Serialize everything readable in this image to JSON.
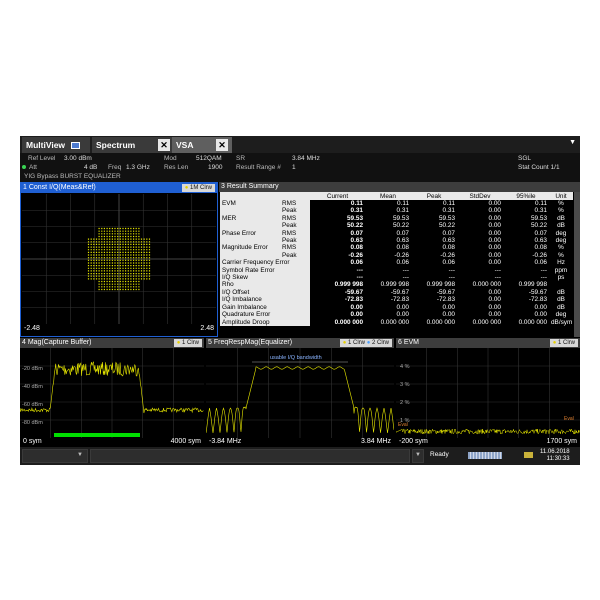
{
  "tabs": {
    "multiview": "MultiView",
    "spectrum": "Spectrum",
    "vsa": "VSA",
    "close": "✕"
  },
  "header": {
    "ref_level_label": "Ref Level",
    "ref_level_value": "3.00 dBm",
    "att_label": "Att",
    "att_value": "4 dB",
    "freq_label": "Freq",
    "freq_value": "1.3 GHz",
    "mod_label": "Mod",
    "mod_value": "512QAM",
    "sr_label": "SR",
    "sr_value": "3.84 MHz",
    "res_len_label": "Res Len",
    "res_len_value": "1900",
    "result_range_label": "Result Range #",
    "result_range_value": "1",
    "sgl": "SGL",
    "stat_count": "Stat Count 1/1",
    "yig_line": "YIG Bypass BURST EQUALIZER"
  },
  "windows": {
    "w1": {
      "title": "1 Const I/Q(Meas&Ref)",
      "badge": "1M Clrw",
      "x_min": "-2.48",
      "x_max": "2.48"
    },
    "w3": {
      "title": "3 Result Summary"
    },
    "w4": {
      "title": "4 Mag(Capture Buffer)",
      "badge": "1 Clrw",
      "x_min": "0 sym",
      "x_max": "4000 sym",
      "y_ticks": [
        "-20 dBm",
        "-40 dBm",
        "-60 dBm",
        "-80 dBm"
      ]
    },
    "w5": {
      "title": "5 FreqRespMag(Equalizer)",
      "badge": "1 Clrw",
      "badge2": "2 Clrw",
      "annotation": "usable I/Q bandwidth",
      "x_min": "-3.84 MHz",
      "x_max": "3.84 MHz"
    },
    "w6": {
      "title": "6 EVM",
      "badge": "1 Clrw",
      "x_min": "-200 sym",
      "x_max": "1700 sym",
      "y_ticks": [
        "4 %",
        "3 %",
        "2 %",
        "1 %"
      ],
      "eval_left": "Eval",
      "eval_right": "Eval"
    }
  },
  "result_summary": {
    "columns": [
      "",
      "",
      "Current",
      "Mean",
      "Peak",
      "StdDev",
      "95%ile",
      "Unit"
    ],
    "rows": [
      [
        "EVM",
        "RMS",
        "0.11",
        "0.11",
        "0.11",
        "0.00",
        "0.11",
        "%"
      ],
      [
        "",
        "Peak",
        "0.31",
        "0.31",
        "0.31",
        "0.00",
        "0.31",
        "%"
      ],
      [
        "MER",
        "RMS",
        "59.53",
        "59.53",
        "59.53",
        "0.00",
        "59.53",
        "dB"
      ],
      [
        "",
        "Peak",
        "50.22",
        "50.22",
        "50.22",
        "0.00",
        "50.22",
        "dB"
      ],
      [
        "Phase Error",
        "RMS",
        "0.07",
        "0.07",
        "0.07",
        "0.00",
        "0.07",
        "deg"
      ],
      [
        "",
        "Peak",
        "0.63",
        "0.63",
        "0.63",
        "0.00",
        "0.63",
        "deg"
      ],
      [
        "Magnitude Error",
        "RMS",
        "0.08",
        "0.08",
        "0.08",
        "0.00",
        "0.08",
        "%"
      ],
      [
        "",
        "Peak",
        "-0.26",
        "-0.26",
        "-0.26",
        "0.00",
        "-0.26",
        "%"
      ],
      [
        "Carrier Frequency Error",
        "",
        "0.06",
        "0.06",
        "0.06",
        "0.00",
        "0.06",
        "Hz"
      ],
      [
        "Symbol Rate Error",
        "",
        "---",
        "---",
        "---",
        "---",
        "---",
        "ppm"
      ],
      [
        "I/Q Skew",
        "",
        "---",
        "---",
        "---",
        "---",
        "---",
        "ps"
      ],
      [
        "Rho",
        "",
        "0.999 998",
        "0.999 998",
        "0.999 998",
        "0.000 000",
        "0.999 998",
        ""
      ],
      [
        "I/Q Offset",
        "",
        "-59.67",
        "-59.67",
        "-59.67",
        "0.00",
        "-59.67",
        "dB"
      ],
      [
        "I/Q Imbalance",
        "",
        "-72.83",
        "-72.83",
        "-72.83",
        "0.00",
        "-72.83",
        "dB"
      ],
      [
        "Gain Imbalance",
        "",
        "0.00",
        "0.00",
        "0.00",
        "0.00",
        "0.00",
        "dB"
      ],
      [
        "Quadrature Error",
        "",
        "0.00",
        "0.00",
        "0.00",
        "0.00",
        "0.00",
        "deg"
      ],
      [
        "Amplitude Droop",
        "",
        "0.000 000",
        "0.000 000",
        "0.000 000",
        "0.000 000",
        "0.000 000",
        "dB/sym"
      ]
    ]
  },
  "status": {
    "ready": "Ready",
    "date": "11.06.2018",
    "time": "11:30:33",
    "progress": 1.0
  },
  "colors": {
    "trace_yellow": "#e6e600",
    "active_blue": "#1f5fd2",
    "marker_green": "#00e000"
  },
  "icons": {
    "dropdown": "dropdown-icon",
    "clock": "clock-icon",
    "flag": "flag-icon"
  }
}
